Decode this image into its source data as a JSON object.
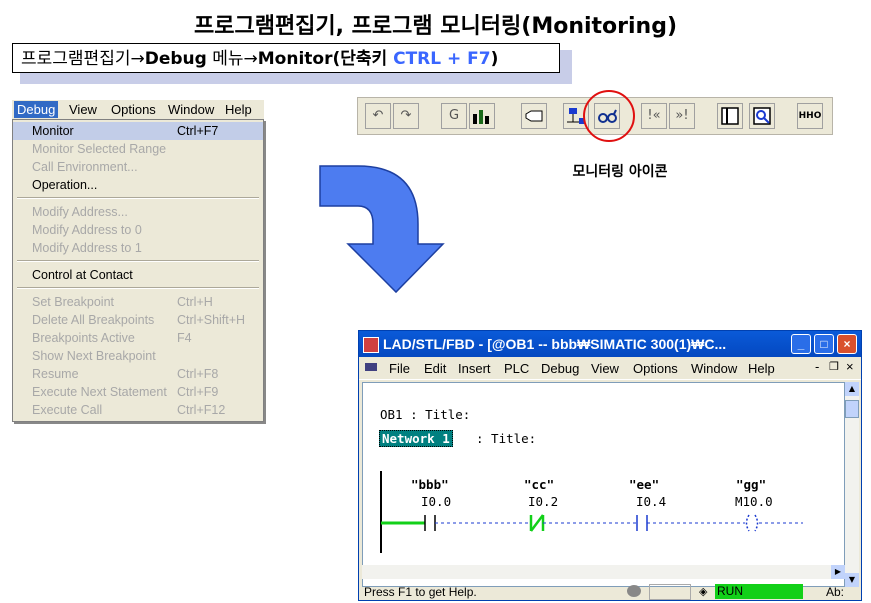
{
  "page": {
    "title": "프로그램편집기, 프로그램 모니터링(Monitoring)",
    "subtitle_a": "프로그램편집기",
    "subtitle_arrow1": "→",
    "subtitle_b": "Debug",
    "subtitle_c": " 메뉴",
    "subtitle_arrow2": "→",
    "subtitle_d": "Monitor",
    "subtitle_e": "(단축키 ",
    "subtitle_shortcut": "CTRL + F7",
    "subtitle_f": ")",
    "toolbar_caption": "모니터링 아이콘"
  },
  "debug_menu": {
    "menubar": [
      "Debug",
      "View",
      "Options",
      "Window",
      "Help"
    ],
    "items": [
      {
        "label": "Monitor",
        "shortcut": "Ctrl+F7",
        "enabled": true,
        "selected": true
      },
      {
        "label": "Monitor Selected Range",
        "shortcut": "",
        "enabled": false
      },
      {
        "label": "Call Environment...",
        "shortcut": "",
        "enabled": false
      },
      {
        "label": "Operation...",
        "shortcut": "",
        "enabled": true
      },
      {
        "label": "Modify Address...",
        "shortcut": "",
        "enabled": false
      },
      {
        "label": "Modify Address to 0",
        "shortcut": "",
        "enabled": false
      },
      {
        "label": "Modify Address to 1",
        "shortcut": "",
        "enabled": false
      },
      {
        "label": "Control at Contact",
        "shortcut": "",
        "enabled": true
      },
      {
        "label": "Set Breakpoint",
        "shortcut": "Ctrl+H",
        "enabled": false
      },
      {
        "label": "Delete All Breakpoints",
        "shortcut": "Ctrl+Shift+H",
        "enabled": false
      },
      {
        "label": "Breakpoints Active",
        "shortcut": "F4",
        "enabled": false
      },
      {
        "label": "Show Next Breakpoint",
        "shortcut": "",
        "enabled": false
      },
      {
        "label": "Resume",
        "shortcut": "Ctrl+F8",
        "enabled": false
      },
      {
        "label": "Execute Next Statement",
        "shortcut": "Ctrl+F9",
        "enabled": false
      },
      {
        "label": "Execute Call",
        "shortcut": "Ctrl+F12",
        "enabled": false
      }
    ]
  },
  "toolbar": {
    "buttons": [
      "undo-icon",
      "redo-icon",
      "overview-icon",
      "module-info-icon",
      "open-block-icon",
      "online-icon",
      "monitor-glasses-icon",
      "step-first-icon",
      "step-last-icon",
      "details-icon",
      "reference-icon",
      "ladder-icon"
    ],
    "glyph_overview": "G",
    "glyph_step_first": "!«",
    "glyph_step_last": "»!",
    "glyph_ladder": "HHO"
  },
  "lad_window": {
    "title": "LAD/STL/FBD  - [@OB1 -- bbb₩SIMATIC 300(1)₩C...",
    "minimize": "_",
    "maximize": "□",
    "close": "×",
    "menu": [
      "File",
      "Edit",
      "Insert",
      "PLC",
      "Debug",
      "View",
      "Options",
      "Window",
      "Help"
    ],
    "inner_min": "-",
    "inner_restore": "❐",
    "inner_close": "×",
    "ob_title": "OB1 : Title:",
    "network_label": "Network 1",
    "network_title": ": Title:",
    "contacts": [
      {
        "symbol": "\"bbb\"",
        "address": "I0.0"
      },
      {
        "symbol": "\"cc\"",
        "address": "I0.2"
      },
      {
        "symbol": "\"ee\"",
        "address": "I0.4"
      },
      {
        "symbol": "\"gg\"",
        "address": "M10.0"
      }
    ],
    "status_text": "Press F1 to get Help.",
    "run_label": "RUN",
    "abs_label": "Ab:"
  },
  "colors": {
    "accent_blue": "#3a66ff",
    "run_green": "#12d018",
    "circle_red": "#e01010",
    "arrow_blue": "#4d7cf0"
  }
}
